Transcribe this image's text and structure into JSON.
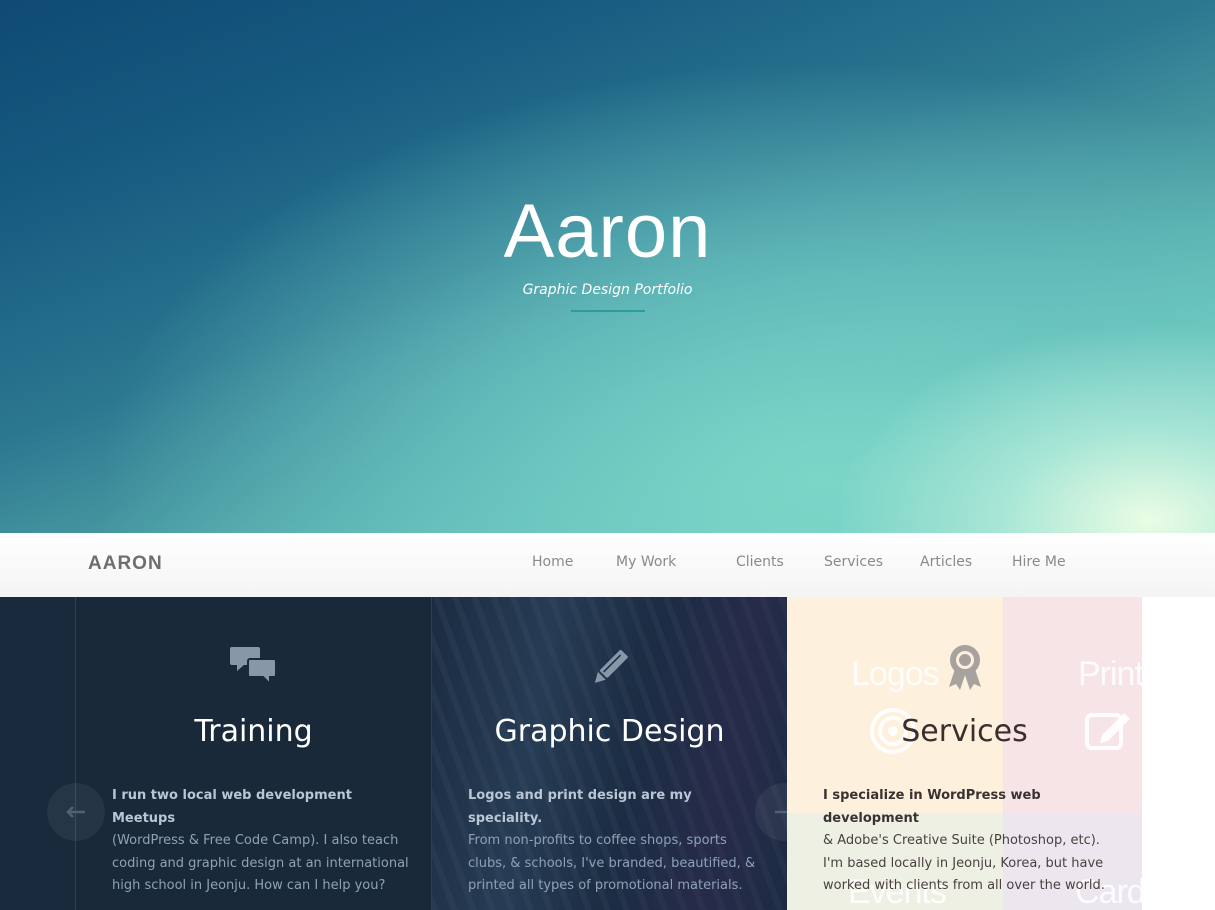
{
  "hero": {
    "title": "Aaron",
    "subtitle": "Graphic Design Portfolio"
  },
  "nav": {
    "brand": "AARON",
    "items": [
      "Home",
      "My Work",
      "Clients",
      "Services",
      "Articles",
      "Hire Me"
    ]
  },
  "panels": [
    {
      "icon": "speech-bubbles-icon",
      "title": "Training",
      "lead": "I run two local web development Meetups",
      "body": "(WordPress & Free Code Camp). I also teach coding and graphic design at an international high school in Jeonju. How can I help you?"
    },
    {
      "icon": "pencil-icon",
      "title": "Graphic Design",
      "lead": "Logos and print design are my speciality.",
      "body": "From non-profits to coffee shops, sports clubs, & schools, I've branded, beautified, & printed all types of promotional materials."
    },
    {
      "icon": "award-ribbon-icon",
      "title": "Services",
      "lead": "I specialize in WordPress web development",
      "body": "& Adobe's Creative Suite (Photoshop, etc). I'm based locally in Jeonju, Korea, but have worked with clients from all over the world.",
      "background_words": [
        "Logos",
        "Print",
        "Events",
        "Card"
      ]
    }
  ],
  "carousel": {
    "prev_icon": "arrow-left-icon",
    "next_icon": "arrow-right-icon"
  },
  "colors": {
    "nav_text": "#8a8a8a",
    "panel_dark": "#19293a",
    "hero_rule": "#2a9e9a"
  }
}
